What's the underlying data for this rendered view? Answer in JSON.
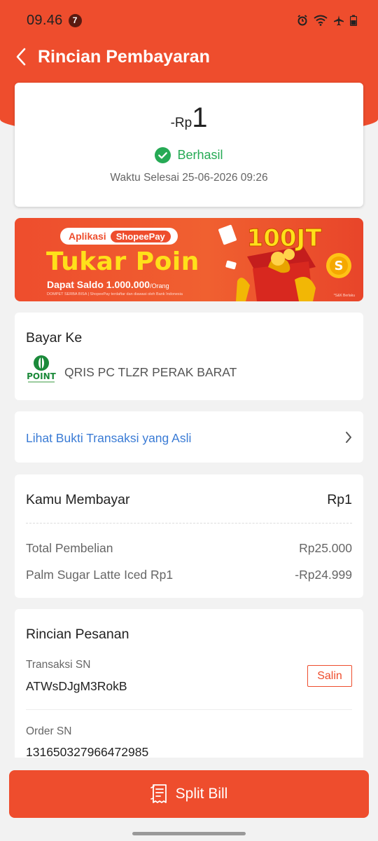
{
  "status_bar": {
    "time": "09.46",
    "notification_count": "7"
  },
  "header": {
    "title": "Rincian Pembayaran"
  },
  "summary": {
    "amount_prefix": "-Rp",
    "amount_value": "1",
    "status": "Berhasil",
    "completed_time": "Waktu Selesai 25-06-2026 09:26"
  },
  "banner": {
    "pill_app": "Aplikasi",
    "pill_brand": "ShopeePay",
    "badge": "100JT",
    "title": "Tukar Poin",
    "subtitle": "Dapat Saldo 1.000.000",
    "subtitle_suffix": "/Orang",
    "fine_print": "DOMPET SERBA BISA | ShopeePay terdaftar dan diawasi oleh Bank Indonesia",
    "fine_print_right": "*S&K Berlaku"
  },
  "pay_to": {
    "title": "Bayar Ke",
    "merchant_logo_text": "POINT",
    "merchant_name": "QRIS PC TLZR PERAK BARAT"
  },
  "proof": {
    "label": "Lihat Bukti Transaksi yang Asli"
  },
  "payment": {
    "title": "Kamu Membayar",
    "total": "Rp1",
    "rows": [
      {
        "label": "Total Pembelian",
        "value": "Rp25.000"
      },
      {
        "label": "Palm Sugar Latte Iced Rp1",
        "value": "-Rp24.999"
      }
    ]
  },
  "order": {
    "title": "Rincian Pesanan",
    "transaction_sn_label": "Transaksi SN",
    "transaction_sn_value": "ATWsDJgM3RokB",
    "copy_label": "Salin",
    "order_sn_label": "Order SN",
    "order_sn_value": "131650327966472985"
  },
  "footer": {
    "split_bill_label": "Split Bill"
  },
  "colors": {
    "brand": "#ee4d2d",
    "success": "#26aa55",
    "link": "#3a7bd5"
  }
}
